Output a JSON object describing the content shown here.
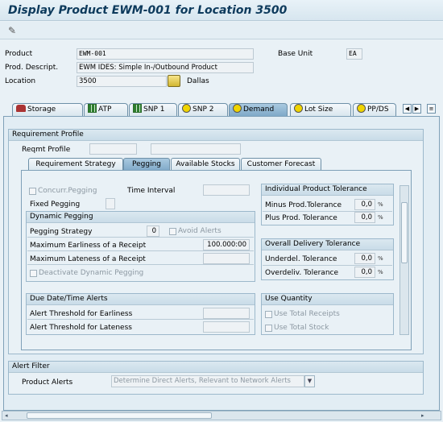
{
  "window": {
    "title": "Display Product EWM-001 for Location 3500"
  },
  "toolbar": {
    "display_change_icon": "pencil-glasses-icon"
  },
  "header": {
    "product_label": "Product",
    "product_value": "EWM-001",
    "descr_label": "Prod. Descript.",
    "descr_value": "EWM IDES: Simple In-/Outbound Product",
    "location_label": "Location",
    "location_value": "3500",
    "location_name": "Dallas",
    "base_unit_label": "Base Unit",
    "base_unit_value": "EA"
  },
  "tabs": [
    {
      "label": "Storage",
      "icon": "car-icon"
    },
    {
      "label": "ATP",
      "icon": "grid-icon"
    },
    {
      "label": "SNP 1",
      "icon": "grid-icon"
    },
    {
      "label": "SNP 2",
      "icon": "circle-icon"
    },
    {
      "label": "Demand",
      "icon": "circle-icon",
      "active": true
    },
    {
      "label": "Lot Size",
      "icon": "circle-icon"
    },
    {
      "label": "PP/DS",
      "icon": "circle-icon"
    }
  ],
  "requirement_profile": {
    "title": "Requirement Profile",
    "reqmt_profile_label": "Reqmt Profile"
  },
  "subtabs": [
    {
      "label": "Requirement Strategy"
    },
    {
      "label": "Pegging",
      "active": true
    },
    {
      "label": "Available Stocks"
    },
    {
      "label": "Customer Forecast"
    }
  ],
  "pegging": {
    "concurr_pegging_label": "Concurr.Pegging",
    "time_interval_label": "Time Interval",
    "fixed_pegging_label": "Fixed Pegging",
    "dynamic_pegging_title": "Dynamic Pegging",
    "pegging_strategy_label": "Pegging Strategy",
    "pegging_strategy_value": "0",
    "avoid_alerts_label": "Avoid Alerts",
    "max_earliness_label": "Maximum Earliness of a Receipt",
    "max_earliness_value": "100.000:00",
    "max_lateness_label": "Maximum Lateness of a Receipt",
    "deactivate_label": "Deactivate Dynamic Pegging",
    "due_alerts_title": "Due Date/Time Alerts",
    "alert_earliness_label": "Alert Threshold for Earliness",
    "alert_lateness_label": "Alert Threshold for Lateness"
  },
  "product_tolerance": {
    "title": "Individual Product Tolerance",
    "minus_label": "Minus Prod.Tolerance",
    "minus_value": "0,0",
    "plus_label": "Plus Prod. Tolerance",
    "plus_value": "0,0",
    "unit": "%"
  },
  "delivery_tolerance": {
    "title": "Overall Delivery Tolerance",
    "under_label": "Underdel. Tolerance",
    "under_value": "0,0",
    "over_label": "Overdeliv. Tolerance",
    "over_value": "0,0",
    "unit": "%"
  },
  "use_quantity": {
    "title": "Use Quantity",
    "total_receipts_label": "Use Total Receipts",
    "total_stock_label": "Use Total Stock"
  },
  "alert_filter": {
    "title": "Alert Filter",
    "product_alerts_label": "Product Alerts",
    "product_alerts_value": "Determine Direct Alerts, Relevant to Network Alerts"
  }
}
